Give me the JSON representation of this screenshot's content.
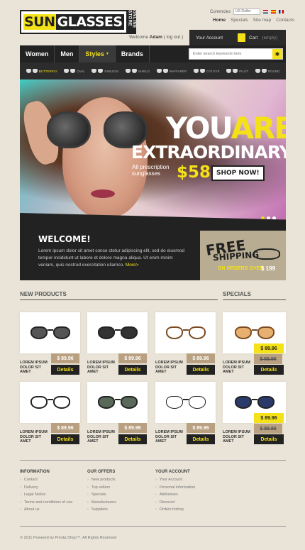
{
  "header": {
    "logo": {
      "part1": "SUN",
      "part2": "GLASSES",
      "side": "ONLINE STORE"
    },
    "currency_label": "Currencies",
    "currency_value": "US Dollar",
    "toplinks": [
      "Home",
      "Specials",
      "Site map",
      "Contacts"
    ],
    "welcome": "Welcome",
    "user": "Adam",
    "logout": "( log out )",
    "your_account": "Your Account",
    "cart_label": "Cart",
    "cart_state": "(empty)"
  },
  "nav": {
    "items": [
      "Women",
      "Men",
      "Styles",
      "Brands"
    ],
    "search_placeholder": "Enter search keywords here"
  },
  "styles": [
    "Butterfly",
    "Oval",
    "Rimless",
    "Shield",
    "Wayfarer",
    "Cat Eye",
    "Pilot",
    "Round"
  ],
  "banner": {
    "word1": "YOU",
    "word2": "ARE",
    "word3": "EXTRAORDINARY",
    "small": "All prescription sunglasses",
    "price": "$58",
    "button": "SHOP NOW!"
  },
  "welcome": {
    "title": "WELCOME!",
    "text": "Lorem ipsum dolor sit amet conse ctetur adipiscing elit, sed do eiusmod tempor incididunt ut labore et dolore magna aliqua. Ut enim minim veniam, quis nostrud exercitation ullamco.",
    "more": "More>"
  },
  "free": {
    "line1": "FREE",
    "line2": "SHIPPING",
    "line3": "ON ORDERS OVER",
    "amount": "$ 199"
  },
  "sections": {
    "new": "NEW PRODUCTS",
    "specials": "SPECIALS"
  },
  "product_name": "LOREM IPSUM DOLOR SIT AMET",
  "price": "$ 89.96",
  "details": "Details",
  "footer": {
    "info_title": "INFORMATION",
    "info": [
      "Contact",
      "Delivery",
      "Legal Notice",
      "Terms and conditions of use",
      "About us"
    ],
    "offers_title": "OUR OFFERS",
    "offers": [
      "New products",
      "Top sellers",
      "Specials",
      "Manufacturers",
      "Suppliers"
    ],
    "account_title": "YOUR ACCOUNT",
    "account": [
      "Your Account",
      "Personal information",
      "Addresses",
      "Discount",
      "Orders history"
    ],
    "copyright": "© 2011 Powered by Presta Shop™. All Rights Reserved"
  },
  "colors": {
    "accent": "#f4e117",
    "dark": "#222222",
    "tan": "#b8a080",
    "bg": "#e9e4d7"
  }
}
